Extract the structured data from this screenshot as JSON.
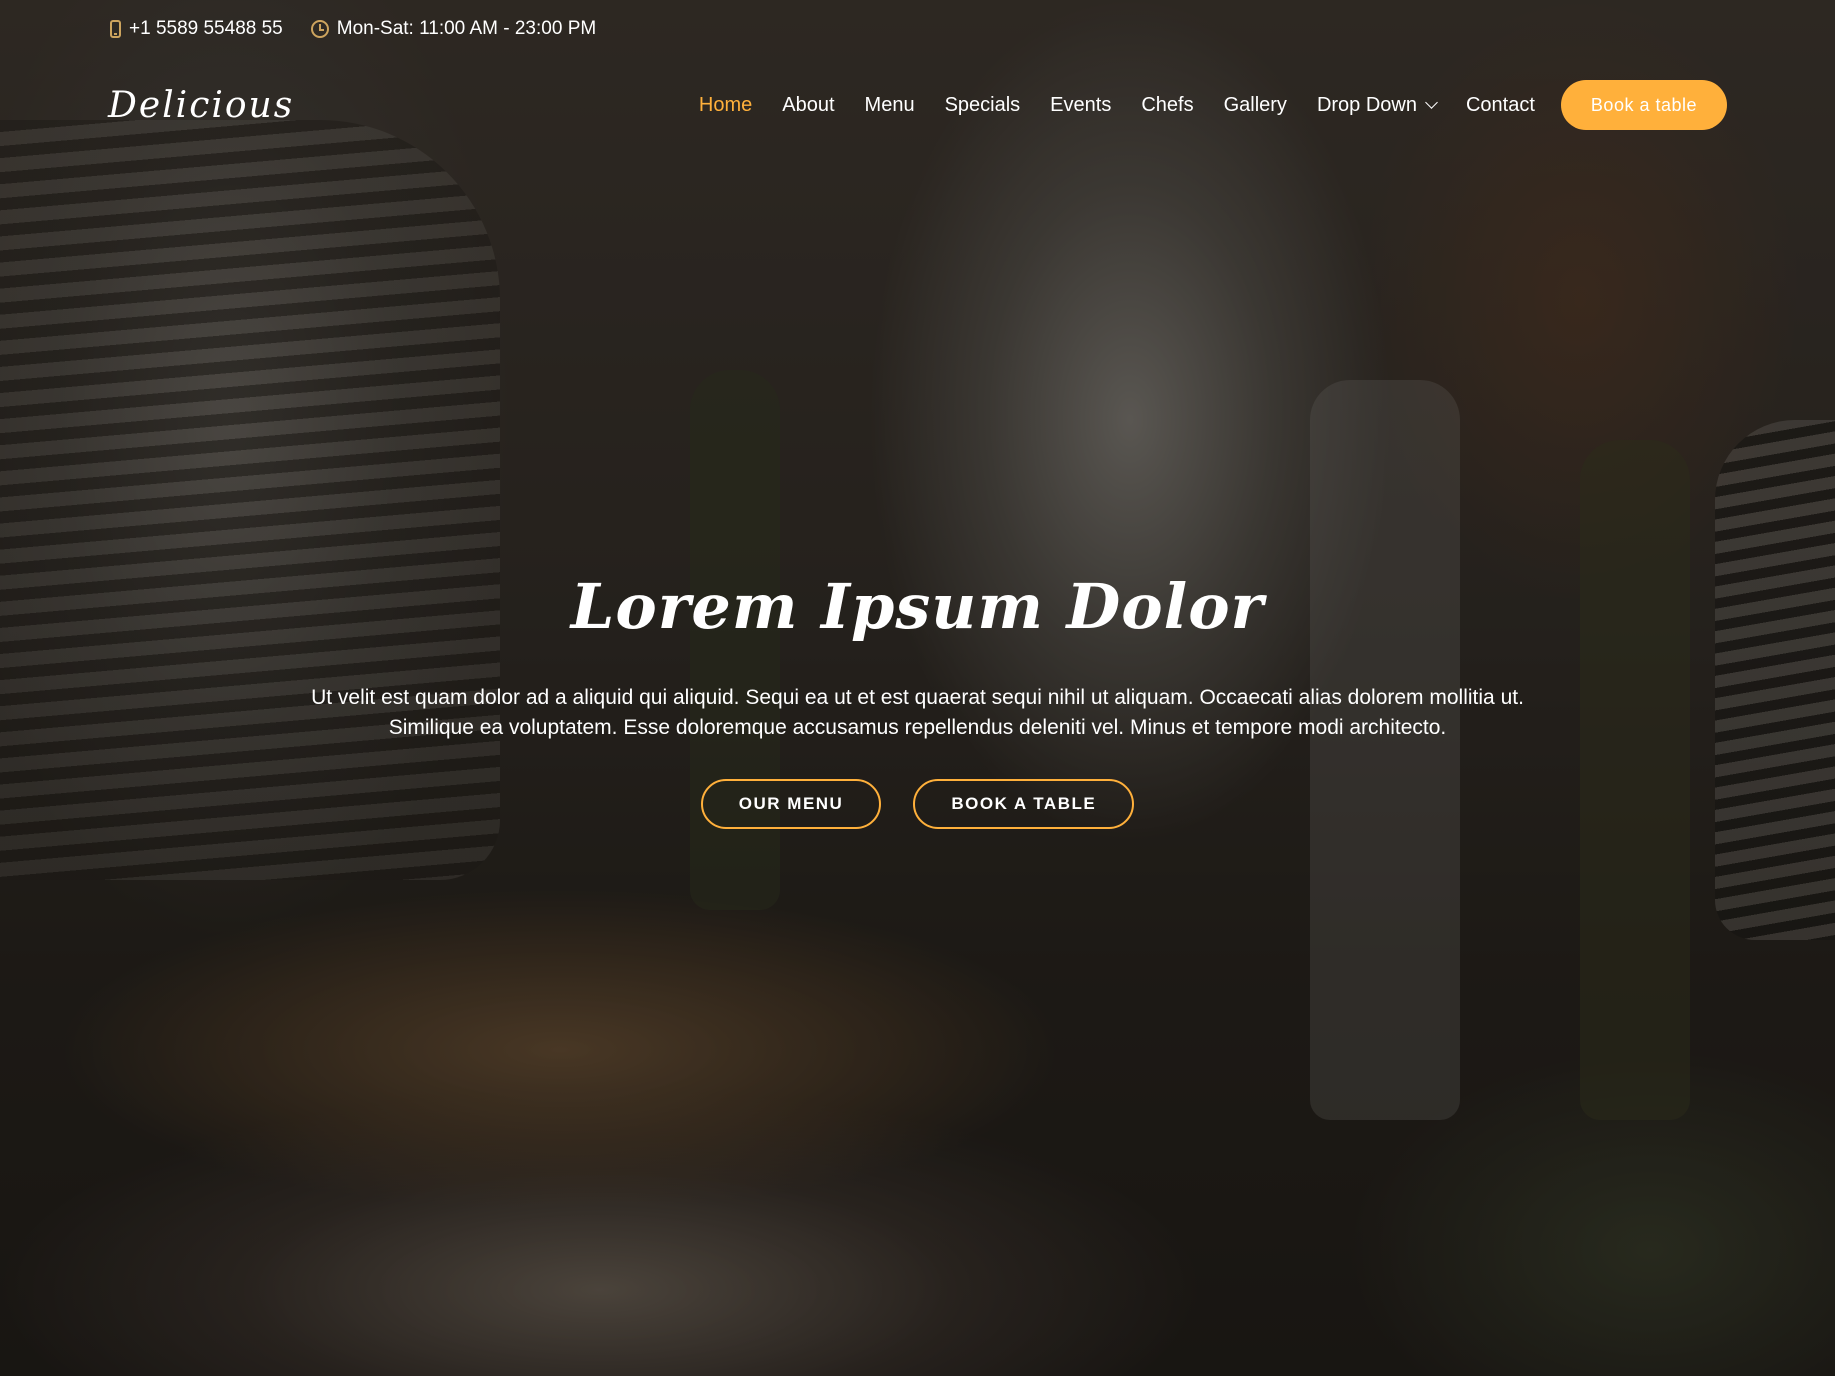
{
  "topbar": {
    "phone": "+1 5589 55488 55",
    "hours": "Mon-Sat: 11:00 AM - 23:00 PM"
  },
  "header": {
    "logo": "Delicious",
    "nav": [
      {
        "label": "Home",
        "active": true
      },
      {
        "label": "About"
      },
      {
        "label": "Menu"
      },
      {
        "label": "Specials"
      },
      {
        "label": "Events"
      },
      {
        "label": "Chefs"
      },
      {
        "label": "Gallery"
      },
      {
        "label": "Drop Down"
      },
      {
        "label": "Contact"
      }
    ],
    "book_button": "Book a table"
  },
  "hero": {
    "title": "Lorem Ipsum Dolor",
    "text": "Ut velit est quam dolor ad a aliquid qui aliquid. Sequi ea ut et est quaerat sequi nihil ut aliquam. Occaecati alias dolorem mollitia ut. Similique ea voluptatem. Esse doloremque accusamus repellendus deleniti vel. Minus et tempore modi architecto.",
    "buttons": {
      "menu": "Our Menu",
      "book": "Book a Table"
    }
  },
  "colors": {
    "accent": "#ffb03b",
    "icon_accent": "#cda45e"
  }
}
